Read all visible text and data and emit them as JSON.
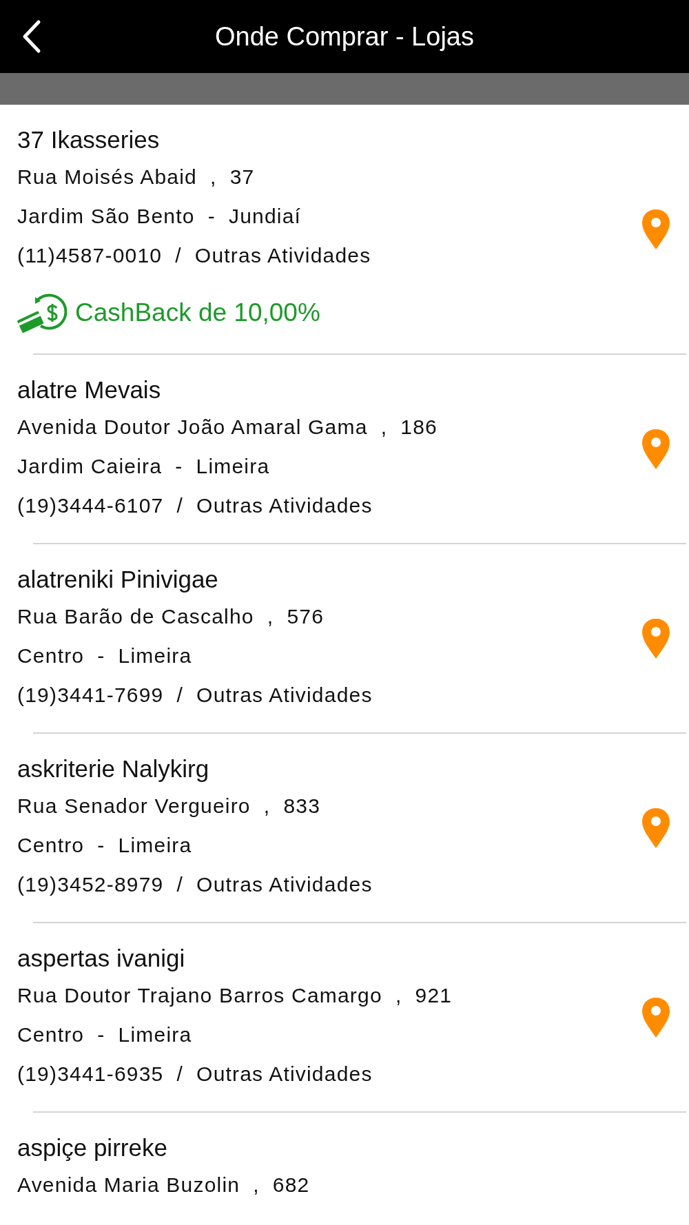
{
  "header": {
    "title": "Onde Comprar - Lojas"
  },
  "stores": [
    {
      "name": "37 Ikasseries",
      "address": "Rua Moisés Abaid  ,  37",
      "area": "Jardim São Bento  -  Jundiaí",
      "contact": "(11)4587-0010  /  Outras Atividades",
      "cashback": "CashBack de 10,00%",
      "pin": true
    },
    {
      "name": "alatre Mevais",
      "address": "Avenida Doutor João Amaral Gama  ,  186",
      "area": "Jardim Caieira  -  Limeira",
      "contact": "(19)3444-6107  /  Outras Atividades",
      "pin": true
    },
    {
      "name": "alatreniki Pinivigae",
      "address": "Rua Barão de Cascalho  ,  576",
      "area": "Centro  -  Limeira",
      "contact": "(19)3441-7699  /  Outras Atividades",
      "pin": true
    },
    {
      "name": "askriterie Nalykirg",
      "address": "Rua Senador Vergueiro  ,  833",
      "area": "Centro  -  Limeira",
      "contact": "(19)3452-8979  /  Outras Atividades",
      "pin": true
    },
    {
      "name": "aspertas ivanigi",
      "address": "Rua Doutor Trajano Barros Camargo  ,  921",
      "area": "Centro  -  Limeira",
      "contact": "(19)3441-6935  /  Outras Atividades",
      "pin": true
    },
    {
      "name": "aspiçe pirreke",
      "address": "Avenida Maria Buzolin  ,  682"
    }
  ]
}
